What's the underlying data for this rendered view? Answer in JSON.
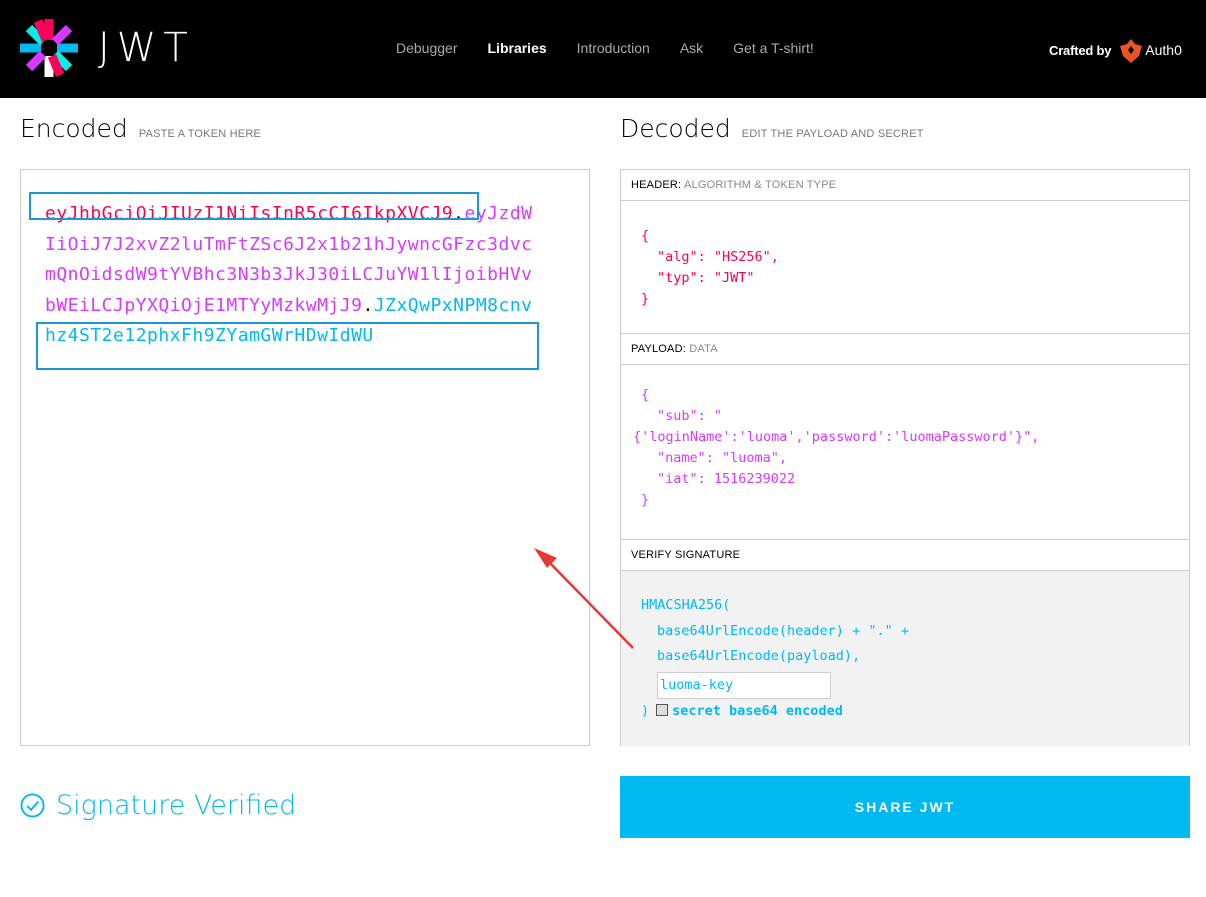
{
  "header": {
    "logo_text": "JWT",
    "nav": [
      {
        "label": "Debugger",
        "active": false
      },
      {
        "label": "Libraries",
        "active": true
      },
      {
        "label": "Introduction",
        "active": false
      },
      {
        "label": "Ask",
        "active": false
      },
      {
        "label": "Get a T-shirt!",
        "active": false
      }
    ],
    "crafted_by": "Crafted by",
    "brand": "Auth0"
  },
  "encoded": {
    "title": "Encoded",
    "subtitle": "PASTE A TOKEN HERE",
    "token_header": "eyJhbGciOiJIUzI1NiIsInR5cCI6IkpXVCJ9",
    "token_payload": "eyJzdWIiOiJ7J2xvZ2luTmFtZSc6J2x1b21hJywncGFzc3dvcmQnOidsdW9tYVBhc3N3b3JkJ30iLCJuYW1lIjoibHVvbWEiLCJpYXQiOjE1MTYyMzkwMjJ9",
    "token_signature": "JZxQwPxNPM8cnvhz4ST2e12phxFh9ZYamGWrHDwIdWU",
    "dot": "."
  },
  "decoded": {
    "title": "Decoded",
    "subtitle": "EDIT THE PAYLOAD AND SECRET",
    "header_section": {
      "label": "HEADER:",
      "sublabel": "ALGORITHM & TOKEN TYPE"
    },
    "header_json": [
      "{",
      "\"alg\": \"HS256\",",
      "\"typ\": \"JWT\"",
      "}"
    ],
    "payload_section": {
      "label": "PAYLOAD:",
      "sublabel": "DATA"
    },
    "payload_json": [
      "{",
      "\"sub\": \"",
      "{'loginName':'luoma','password':'luomaPassword'}\",",
      "\"name\": \"luoma\",",
      "\"iat\": 1516239022",
      "}"
    ],
    "signature_section": {
      "label": "VERIFY SIGNATURE"
    },
    "signature": {
      "fn": "HMACSHA256(",
      "line1": "base64UrlEncode(header) + \".\" +",
      "line2": "base64UrlEncode(payload),",
      "secret_value": "luoma-key",
      "close": ")",
      "checkbox_label": "secret base64 encoded"
    }
  },
  "status": {
    "verified_text": "Signature Verified"
  },
  "share_button": "SHARE JWT",
  "colors": {
    "header": "#fb015b",
    "payload": "#d63aff",
    "signature": "#00b9f1",
    "annotation_box": "#1e96d2",
    "annotation_arrow": "#e53935"
  }
}
